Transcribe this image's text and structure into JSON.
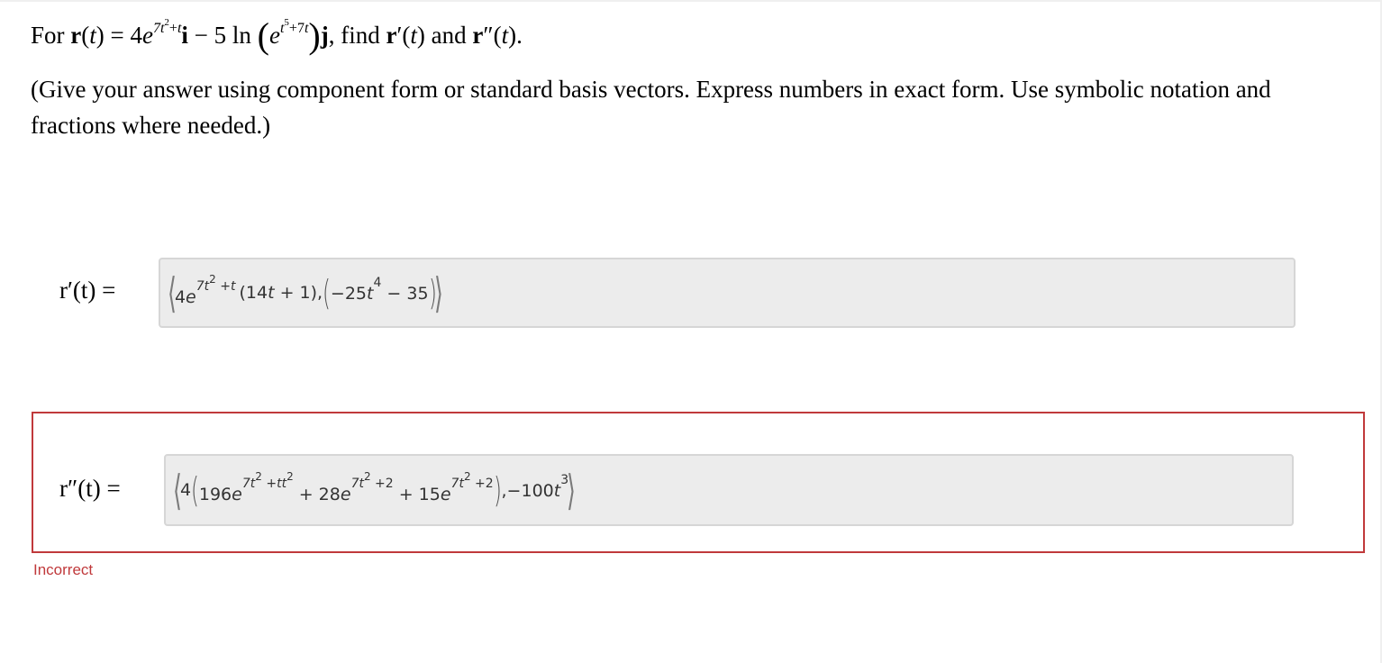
{
  "question": {
    "prefix": "For",
    "suffix_find": "find",
    "and_word": "and",
    "instructions": "(Give your answer using component form or standard basis vectors. Express numbers in exact form. Use symbolic notation and fractions where needed.)"
  },
  "first_derivative": {
    "label": "r′(t) ="
  },
  "second_derivative": {
    "label": "r″(t) ="
  },
  "status": {
    "text": "Incorrect",
    "color": "#c0393b"
  },
  "colors": {
    "error_border": "#c0393b",
    "input_background": "#ececec",
    "input_border": "#d6d6d6"
  }
}
